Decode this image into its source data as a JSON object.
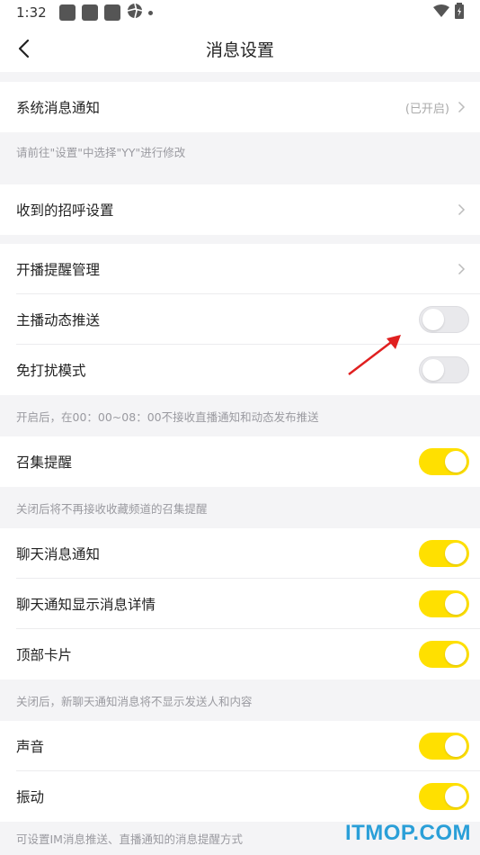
{
  "status_bar": {
    "time": "1:32"
  },
  "nav": {
    "title": "消息设置"
  },
  "sections": {
    "system_notice": {
      "label": "系统消息通知",
      "value": "(已开启)"
    },
    "system_note": "请前往\"设置\"中选择\"YY\"进行修改",
    "greeting": {
      "label": "收到的招呼设置"
    },
    "live_remind": {
      "label": "开播提醒管理"
    },
    "anchor_push": {
      "label": "主播动态推送",
      "toggle": "off"
    },
    "dnd": {
      "label": "免打扰模式",
      "toggle": "off"
    },
    "dnd_note": "开启后，在00：00~08：00不接收直播通知和动态发布推送",
    "gather": {
      "label": "召集提醒",
      "toggle": "on"
    },
    "gather_note": "关闭后将不再接收收藏频道的召集提醒",
    "chat_notice": {
      "label": "聊天消息通知",
      "toggle": "on"
    },
    "chat_detail": {
      "label": "聊天通知显示消息详情",
      "toggle": "on"
    },
    "top_card": {
      "label": "顶部卡片",
      "toggle": "on"
    },
    "chat_note": "关闭后，新聊天通知消息将不显示发送人和内容",
    "sound": {
      "label": "声音",
      "toggle": "on"
    },
    "vibrate": {
      "label": "振动",
      "toggle": "on"
    },
    "im_note": "可设置IM消息推送、直播通知的消息提醒方式"
  },
  "watermark": "ITMOP.COM",
  "colors": {
    "toggle_on": "#ffe000",
    "toggle_off": "#e9e9ec",
    "watermark": "#2a9fd8",
    "arrow": "#e02020"
  }
}
